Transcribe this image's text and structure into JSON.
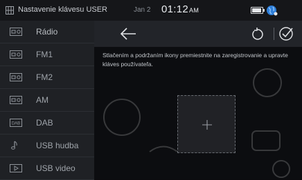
{
  "status_bar": {
    "title": "Nastavenie klávesu USER",
    "date": "Jan 2",
    "time": "01:12",
    "ampm": "AM"
  },
  "sidebar": {
    "items": [
      {
        "label": "Rádio",
        "icon": "radio-icon"
      },
      {
        "label": "FM1",
        "icon": "radio-icon"
      },
      {
        "label": "FM2",
        "icon": "radio-icon"
      },
      {
        "label": "AM",
        "icon": "radio-icon"
      },
      {
        "label": "DAB",
        "icon": "dab-icon"
      },
      {
        "label": "USB hudba",
        "icon": "music-note-icon"
      },
      {
        "label": "USB video",
        "icon": "video-icon"
      }
    ]
  },
  "main": {
    "instruction": "Stlačením a podržaním ikony premiestnite na zaregistrovanie a upravte kláves používateľa."
  },
  "colors": {
    "sidebar_bg": "#1f2125",
    "header_bg": "#222429",
    "text": "#cfd3d8"
  }
}
